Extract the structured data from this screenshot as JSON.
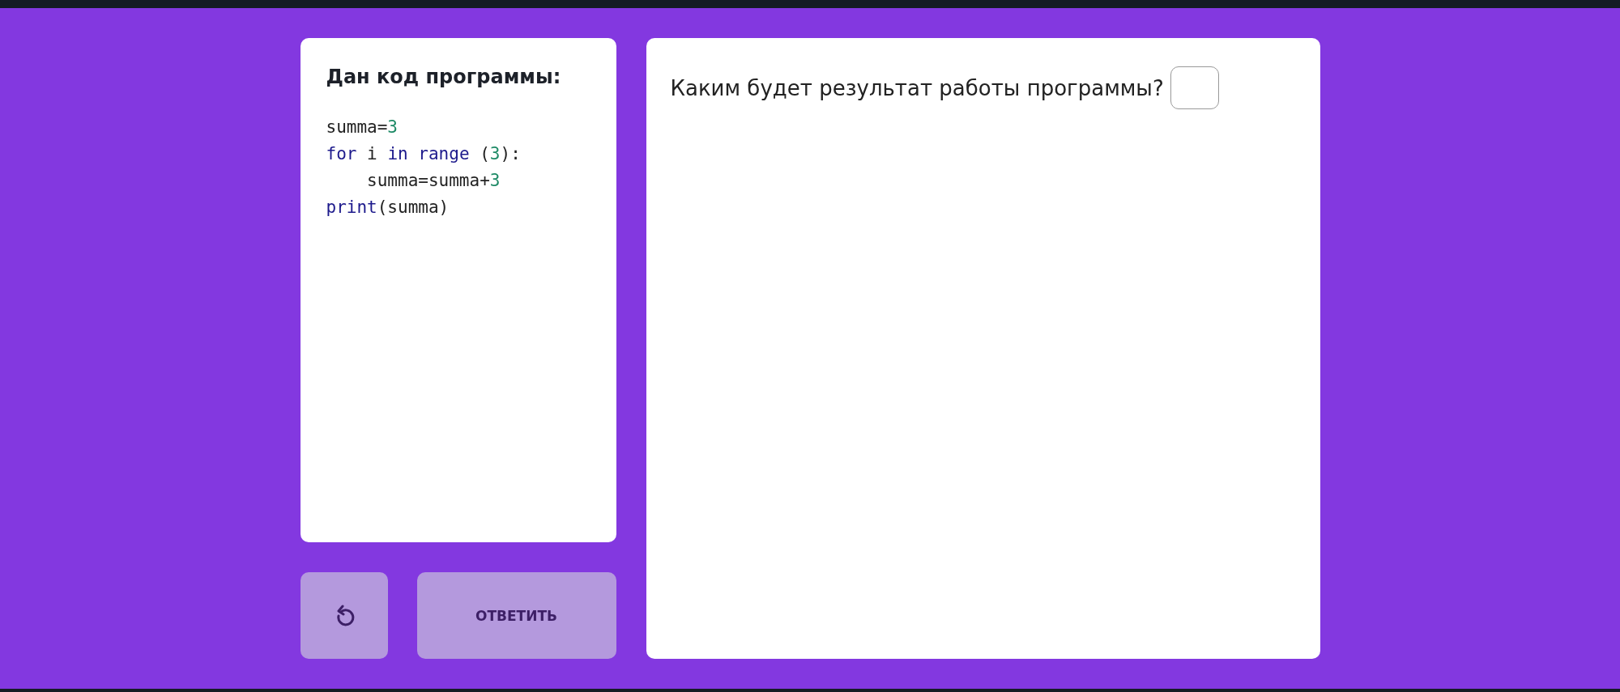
{
  "code_panel": {
    "title": "Дан код программы:",
    "lines": [
      {
        "tokens": [
          {
            "kind": "plain",
            "text": "summa="
          },
          {
            "kind": "number",
            "text": "3"
          }
        ]
      },
      {
        "tokens": [
          {
            "kind": "keyword",
            "text": "for"
          },
          {
            "kind": "plain",
            "text": " i "
          },
          {
            "kind": "keyword",
            "text": "in range"
          },
          {
            "kind": "plain",
            "text": " ("
          },
          {
            "kind": "number",
            "text": "3"
          },
          {
            "kind": "plain",
            "text": "):"
          }
        ]
      },
      {
        "tokens": [
          {
            "kind": "plain",
            "text": "    summa=summa+"
          },
          {
            "kind": "number",
            "text": "3"
          }
        ]
      },
      {
        "tokens": [
          {
            "kind": "keyword",
            "text": "print"
          },
          {
            "kind": "plain",
            "text": "(summa)"
          }
        ]
      }
    ]
  },
  "actions": {
    "submit_label": "ОТВЕТИТЬ"
  },
  "question": {
    "text": "Каким будет результат работы программы?"
  }
}
